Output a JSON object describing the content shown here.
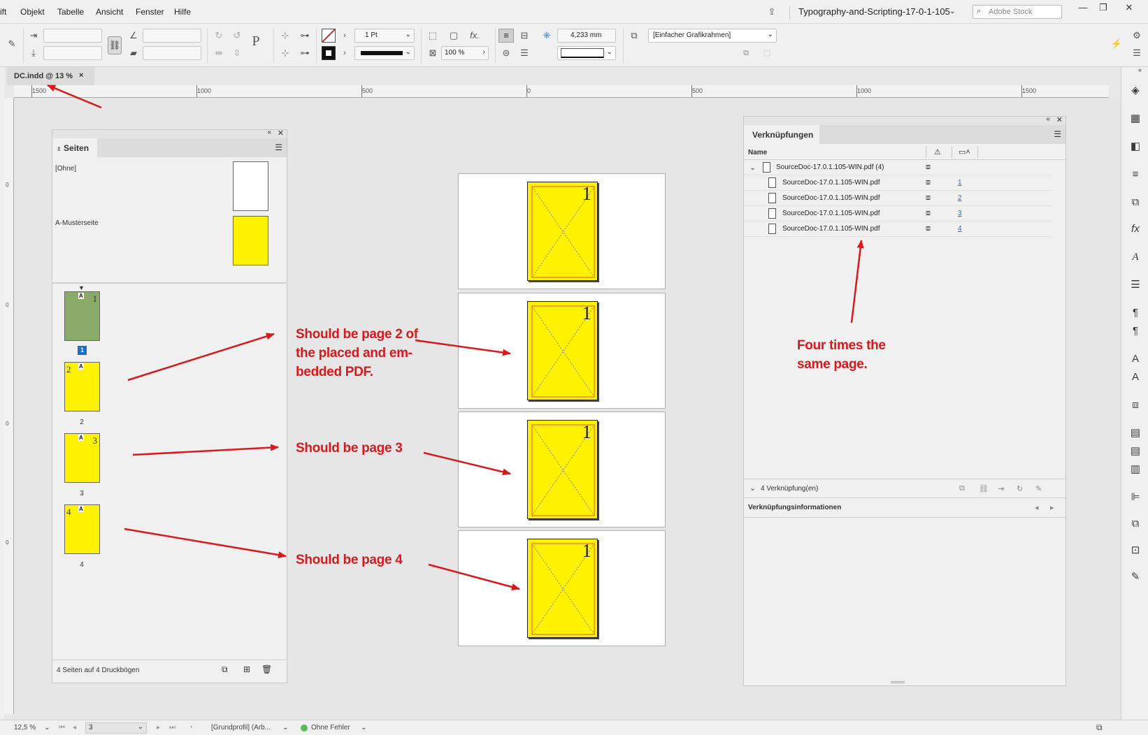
{
  "menubar": {
    "items": [
      "ift",
      "Objekt",
      "Tabelle",
      "Ansicht",
      "Fenster",
      "Hilfe"
    ],
    "workspace_title": "Typography-and-Scripting-17-0-1-105",
    "stock_placeholder": "Adobe Stock"
  },
  "controlbar": {
    "stroke_weight": "1 Pt",
    "scale_percent": "100 %",
    "gap_value": "4,233 mm",
    "object_style": "[Einfacher Grafikrahmen]"
  },
  "document_tab": {
    "label": "DC.indd @ 13 %",
    "close": "×"
  },
  "ruler": {
    "labels": [
      "1500",
      "1000",
      "500",
      "0",
      "500",
      "1000",
      "1500"
    ],
    "vertical_labels": [
      "0",
      "0",
      "0",
      "0"
    ]
  },
  "pages_panel": {
    "title": "Seiten",
    "masters": [
      "[Ohne]",
      "A-Musterseite"
    ],
    "pages": [
      {
        "prefix": "A",
        "number": "1",
        "label": "1",
        "active": true
      },
      {
        "prefix": "A",
        "number": "2",
        "label": "2",
        "active": false
      },
      {
        "prefix": "A",
        "number": "3",
        "label": "3",
        "active": false
      },
      {
        "prefix": "A",
        "number": "4",
        "label": "4",
        "active": false
      }
    ],
    "footer": "4 Seiten auf 4 Druckbögen"
  },
  "document_pages": [
    {
      "placed_page_number": "1"
    },
    {
      "placed_page_number": "1"
    },
    {
      "placed_page_number": "1"
    },
    {
      "placed_page_number": "1"
    }
  ],
  "links_panel": {
    "title": "Verknüpfungen",
    "column_name": "Name",
    "parent": "SourceDoc-17.0.1.105-WIN.pdf (4)",
    "links": [
      {
        "name": "SourceDoc-17.0.1.105-WIN.pdf",
        "page": "1"
      },
      {
        "name": "SourceDoc-17.0.1.105-WIN.pdf",
        "page": "2"
      },
      {
        "name": "SourceDoc-17.0.1.105-WIN.pdf",
        "page": "3"
      },
      {
        "name": "SourceDoc-17.0.1.105-WIN.pdf",
        "page": "4"
      }
    ],
    "count": "4 Verknüpfung(en)",
    "info_title": "Verknüpfungsinformationen"
  },
  "annotations": {
    "page2": "Should be page 2 of the placed and em-bedded PDF.",
    "page2_lines": [
      "Should be page 2 of",
      "the placed and em-",
      "bedded PDF."
    ],
    "page3": "Should be page 3",
    "page4": "Should be page 4",
    "four_times": [
      "Four times the",
      "same page."
    ]
  },
  "statusbar": {
    "zoom": "12,5 %",
    "page_field": "3",
    "profile": "[Grundprofil] (Arb...",
    "preflight": "Ohne Fehler"
  },
  "colors": {
    "page_yellow": "#fff200",
    "annotation_red": "#d9191c",
    "active_page": "#8aaa6a",
    "selection_blue": "#1a6ec7"
  }
}
